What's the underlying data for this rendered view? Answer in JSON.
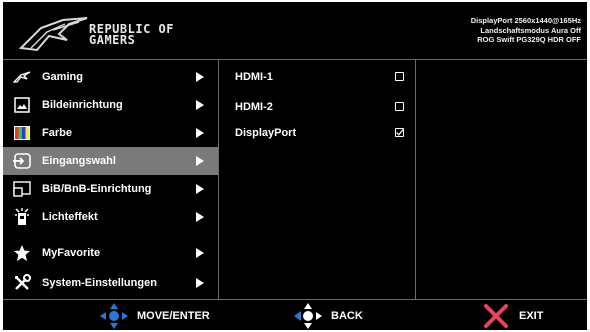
{
  "header": {
    "brand_line1": "REPUBLIC OF",
    "brand_line2": "GAMERS",
    "status_line1": "DisplayPort 2560x1440@165Hz",
    "status_line2": "Landschaftsmodus Aura Off",
    "status_line3": "ROG Swift PG329Q HDR OFF"
  },
  "menu": {
    "items": [
      {
        "label": "Gaming",
        "icon": "rog-eye-icon",
        "selected": false
      },
      {
        "label": "Bildeinrichtung",
        "icon": "image-icon",
        "selected": false
      },
      {
        "label": "Farbe",
        "icon": "color-bars-icon",
        "selected": false
      },
      {
        "label": "Eingangswahl",
        "icon": "input-icon",
        "selected": true
      },
      {
        "label": "BiB/BnB-Einrichtung",
        "icon": "pip-icon",
        "selected": false
      },
      {
        "label": "Lichteffekt",
        "icon": "light-effect-icon",
        "selected": false
      },
      {
        "label": "MyFavorite",
        "icon": "star-icon",
        "selected": false
      },
      {
        "label": "System-Einstellungen",
        "icon": "tools-icon",
        "selected": false
      }
    ]
  },
  "submenu": {
    "items": [
      {
        "label": "HDMI-1",
        "checked": false
      },
      {
        "label": "HDMI-2",
        "checked": false
      },
      {
        "label": "DisplayPort",
        "checked": true
      }
    ]
  },
  "footer": {
    "move_label": "MOVE/ENTER",
    "back_label": "BACK",
    "exit_label": "EXIT"
  },
  "colors": {
    "background": "#000000",
    "selected": "#7a7a7a",
    "divider": "#6b6b6b",
    "joystick_blue": "#2a78d6",
    "exit_red": "#e8455a"
  }
}
